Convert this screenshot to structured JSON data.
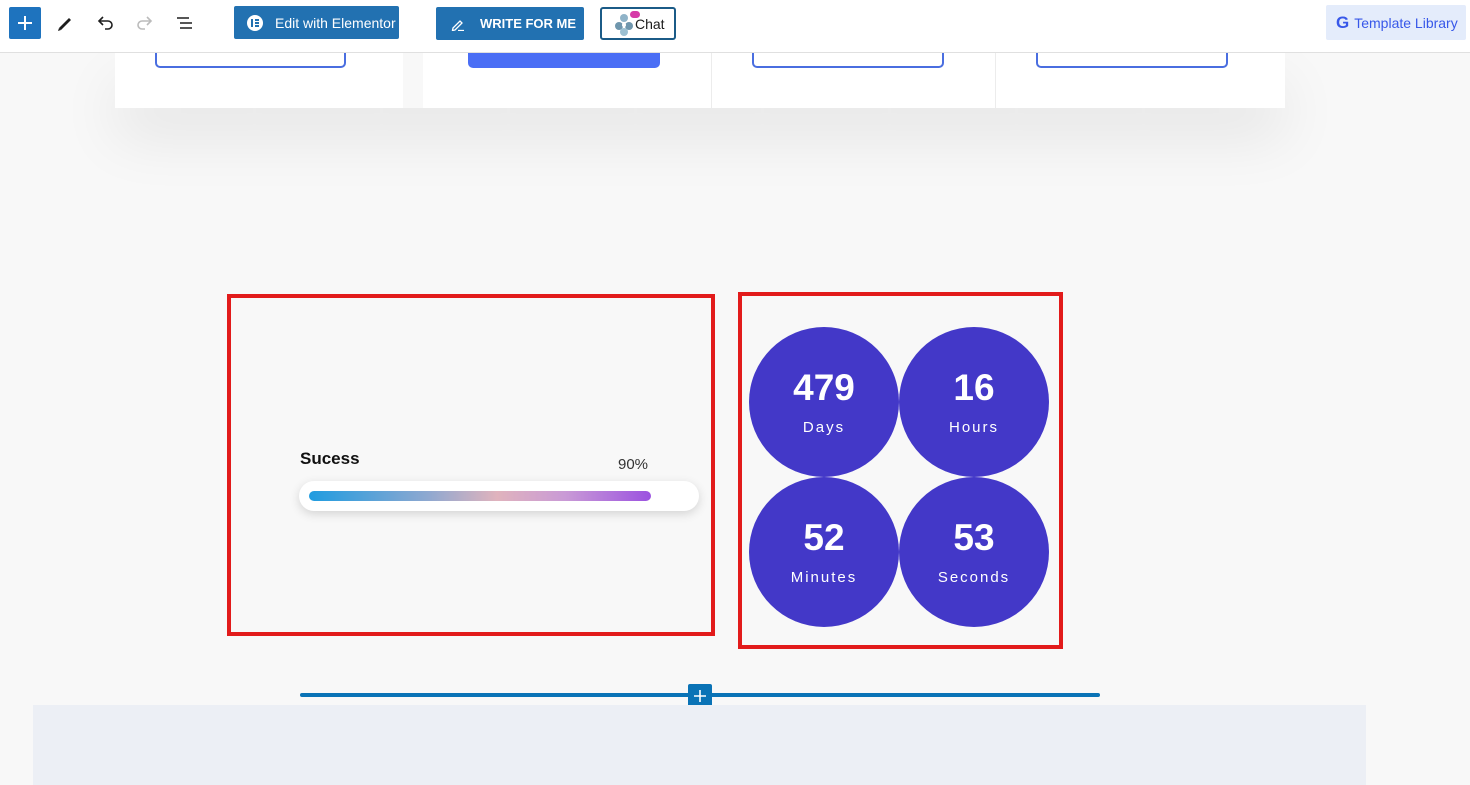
{
  "toolbar": {
    "edit_with_elementor": "Edit with Elementor",
    "write_for_me": "WRITE FOR ME",
    "chat": "Chat",
    "template_library": "Template Library",
    "icons": [
      "add-block-icon",
      "edit-pencil-icon",
      "undo-icon",
      "redo-icon",
      "document-overview-icon"
    ]
  },
  "progress": {
    "title": "Sucess",
    "percent_label": "90%",
    "value": 0.9
  },
  "countdown": [
    {
      "value": "479",
      "label": "Days"
    },
    {
      "value": "16",
      "label": "Hours"
    },
    {
      "value": "52",
      "label": "Minutes"
    },
    {
      "value": "53",
      "label": "Seconds"
    }
  ],
  "colors": {
    "primary": "#2271b1",
    "countdown_bg": "#4338c8",
    "highlight": "#e21b1b",
    "section_line": "#0a73b6"
  }
}
